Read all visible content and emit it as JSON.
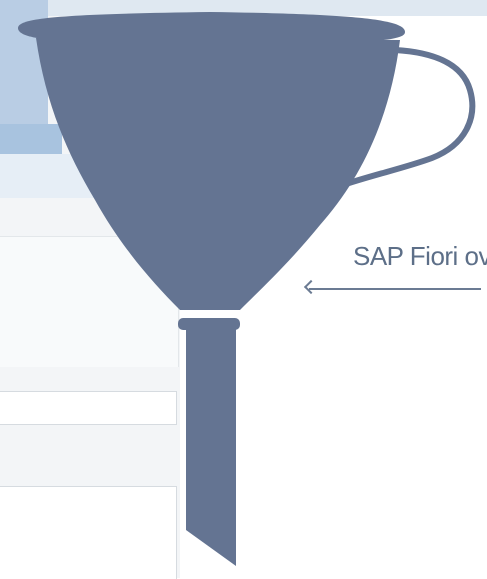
{
  "annotation": {
    "label": "SAP Fiori ov"
  },
  "funnel": {
    "icon": "funnel-icon",
    "color": "#647492"
  },
  "colors": {
    "funnel": "#647492",
    "annotation_text": "#5d6f88",
    "annotation_line": "#6b7b93",
    "background_accent": "#b9cde4"
  }
}
